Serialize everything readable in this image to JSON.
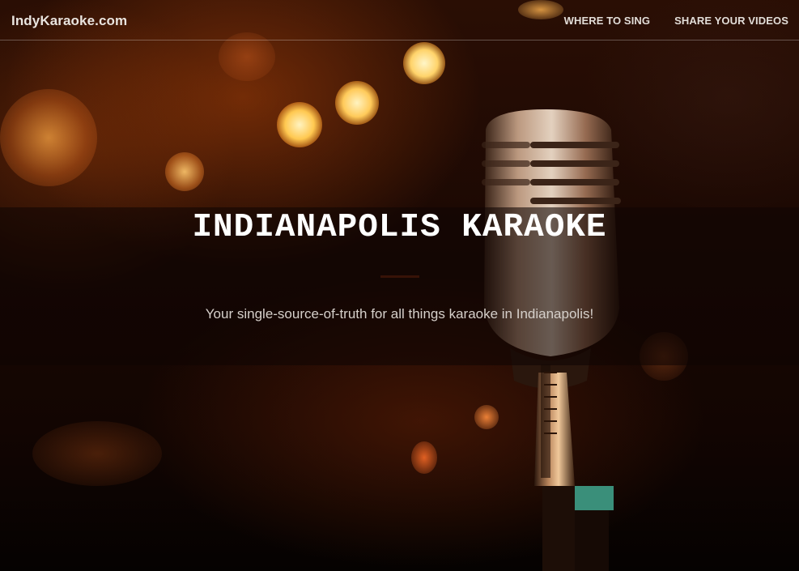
{
  "nav": {
    "brand": "IndyKaraoke.com",
    "links": [
      {
        "label": "WHERE TO SING"
      },
      {
        "label": "SHARE YOUR VIDEOS"
      }
    ]
  },
  "hero": {
    "title": "INDIANAPOLIS KARAOKE",
    "tagline": "Your single-source-of-truth for all things karaoke in Indianapolis!"
  },
  "colors": {
    "background_dark": "#1a0803",
    "bokeh_orange": "#ffca5a",
    "text_white": "#ffffff"
  }
}
